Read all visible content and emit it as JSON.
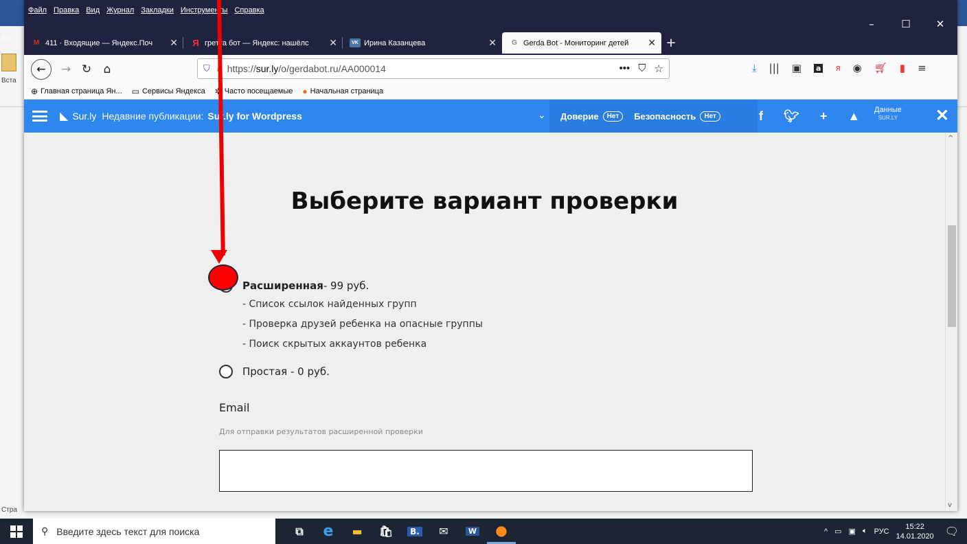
{
  "background_app": {
    "side_labels": [
      "Фа",
      "Вста",
      "Стра"
    ]
  },
  "browser": {
    "menu": [
      "Файл",
      "Правка",
      "Вид",
      "Журнал",
      "Закладки",
      "Инструменты",
      "Справка"
    ],
    "tabs": [
      {
        "icon": "mail-icon",
        "icon_char": "M",
        "icon_color": "#d93025",
        "title": "411 · Входящие — Яндекс.Поч",
        "active": false
      },
      {
        "icon": "yandex-icon",
        "icon_char": "Я",
        "icon_color": "#ff3333",
        "title": "гретта бот — Яндекс: нашёлс",
        "active": false
      },
      {
        "icon": "vk-icon",
        "icon_char": "VK",
        "icon_color": "#4a76a8",
        "title": "Ирина Казанцева",
        "active": false
      },
      {
        "icon": "gerda-icon",
        "icon_char": "G",
        "icon_color": "#888888",
        "title": "Gerda Bot - Мониторинг детей",
        "active": true
      }
    ],
    "url": {
      "prefix": "https://",
      "host": "sur.ly",
      "path": "/o/gerdabot.ru/AA000014"
    },
    "bookmarks": [
      {
        "icon": "globe-icon",
        "label": "Главная страница Ян..."
      },
      {
        "icon": "folder-icon",
        "label": "Сервисы Яндекса"
      },
      {
        "icon": "gear-icon",
        "label": "Часто посещаемые"
      },
      {
        "icon": "firefox-icon",
        "label": "Начальная страница"
      }
    ]
  },
  "surly_bar": {
    "brand": "Sur.ly",
    "recent_label": "Недавние публикации:",
    "publication": "Sur.ly for Wordpress",
    "trust_label": "Доверие",
    "trust_value": "Нет",
    "security_label": "Безопасность",
    "security_value": "Нет",
    "data_label": "Данные",
    "data_sub": "SUR.LY"
  },
  "page": {
    "heading": "Выберите вариант проверки",
    "option_extended": {
      "name": "Расширенная",
      "price": " - 99 руб."
    },
    "extended_features": [
      "- Список ссылок найденных групп",
      "- Проверка друзей ребенка на опасные группы",
      "- Поиск скрытых аккаунтов ребенка"
    ],
    "option_simple": "Простая - 0 руб.",
    "email_label": "Email",
    "email_hint": "Для отправки результатов расширенной проверки",
    "email_value": ""
  },
  "taskbar": {
    "search_placeholder": "Введите здесь текст для поиска",
    "language": "РУС",
    "time": "15:22",
    "date": "14.01.2020"
  },
  "colors": {
    "surly_blue": "#2e86ef",
    "annotation_red": "#ff0000",
    "tabbar": "#202340"
  }
}
